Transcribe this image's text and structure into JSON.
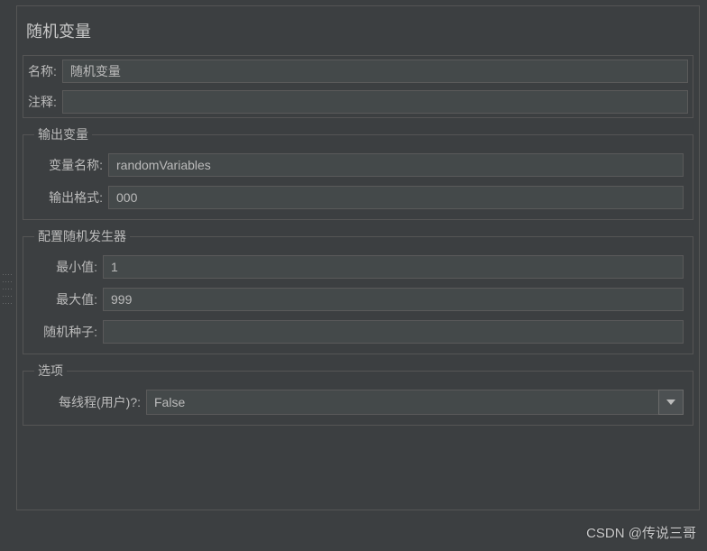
{
  "title": "随机变量",
  "common": {
    "name_label": "名称:",
    "name_value": "随机变量",
    "comment_label": "注释:",
    "comment_value": ""
  },
  "output": {
    "legend": "输出变量",
    "var_name_label": "变量名称:",
    "var_name_value": "randomVariables",
    "format_label": "输出格式:",
    "format_value": "000"
  },
  "random": {
    "legend": "配置随机发生器",
    "min_label": "最小值:",
    "min_value": "1",
    "max_label": "最大值:",
    "max_value": "999",
    "seed_label": "随机种子:",
    "seed_value": ""
  },
  "options": {
    "legend": "选项",
    "per_thread_label": "每线程(用户)?:",
    "per_thread_value": "False"
  },
  "watermark": "CSDN @传说三哥"
}
